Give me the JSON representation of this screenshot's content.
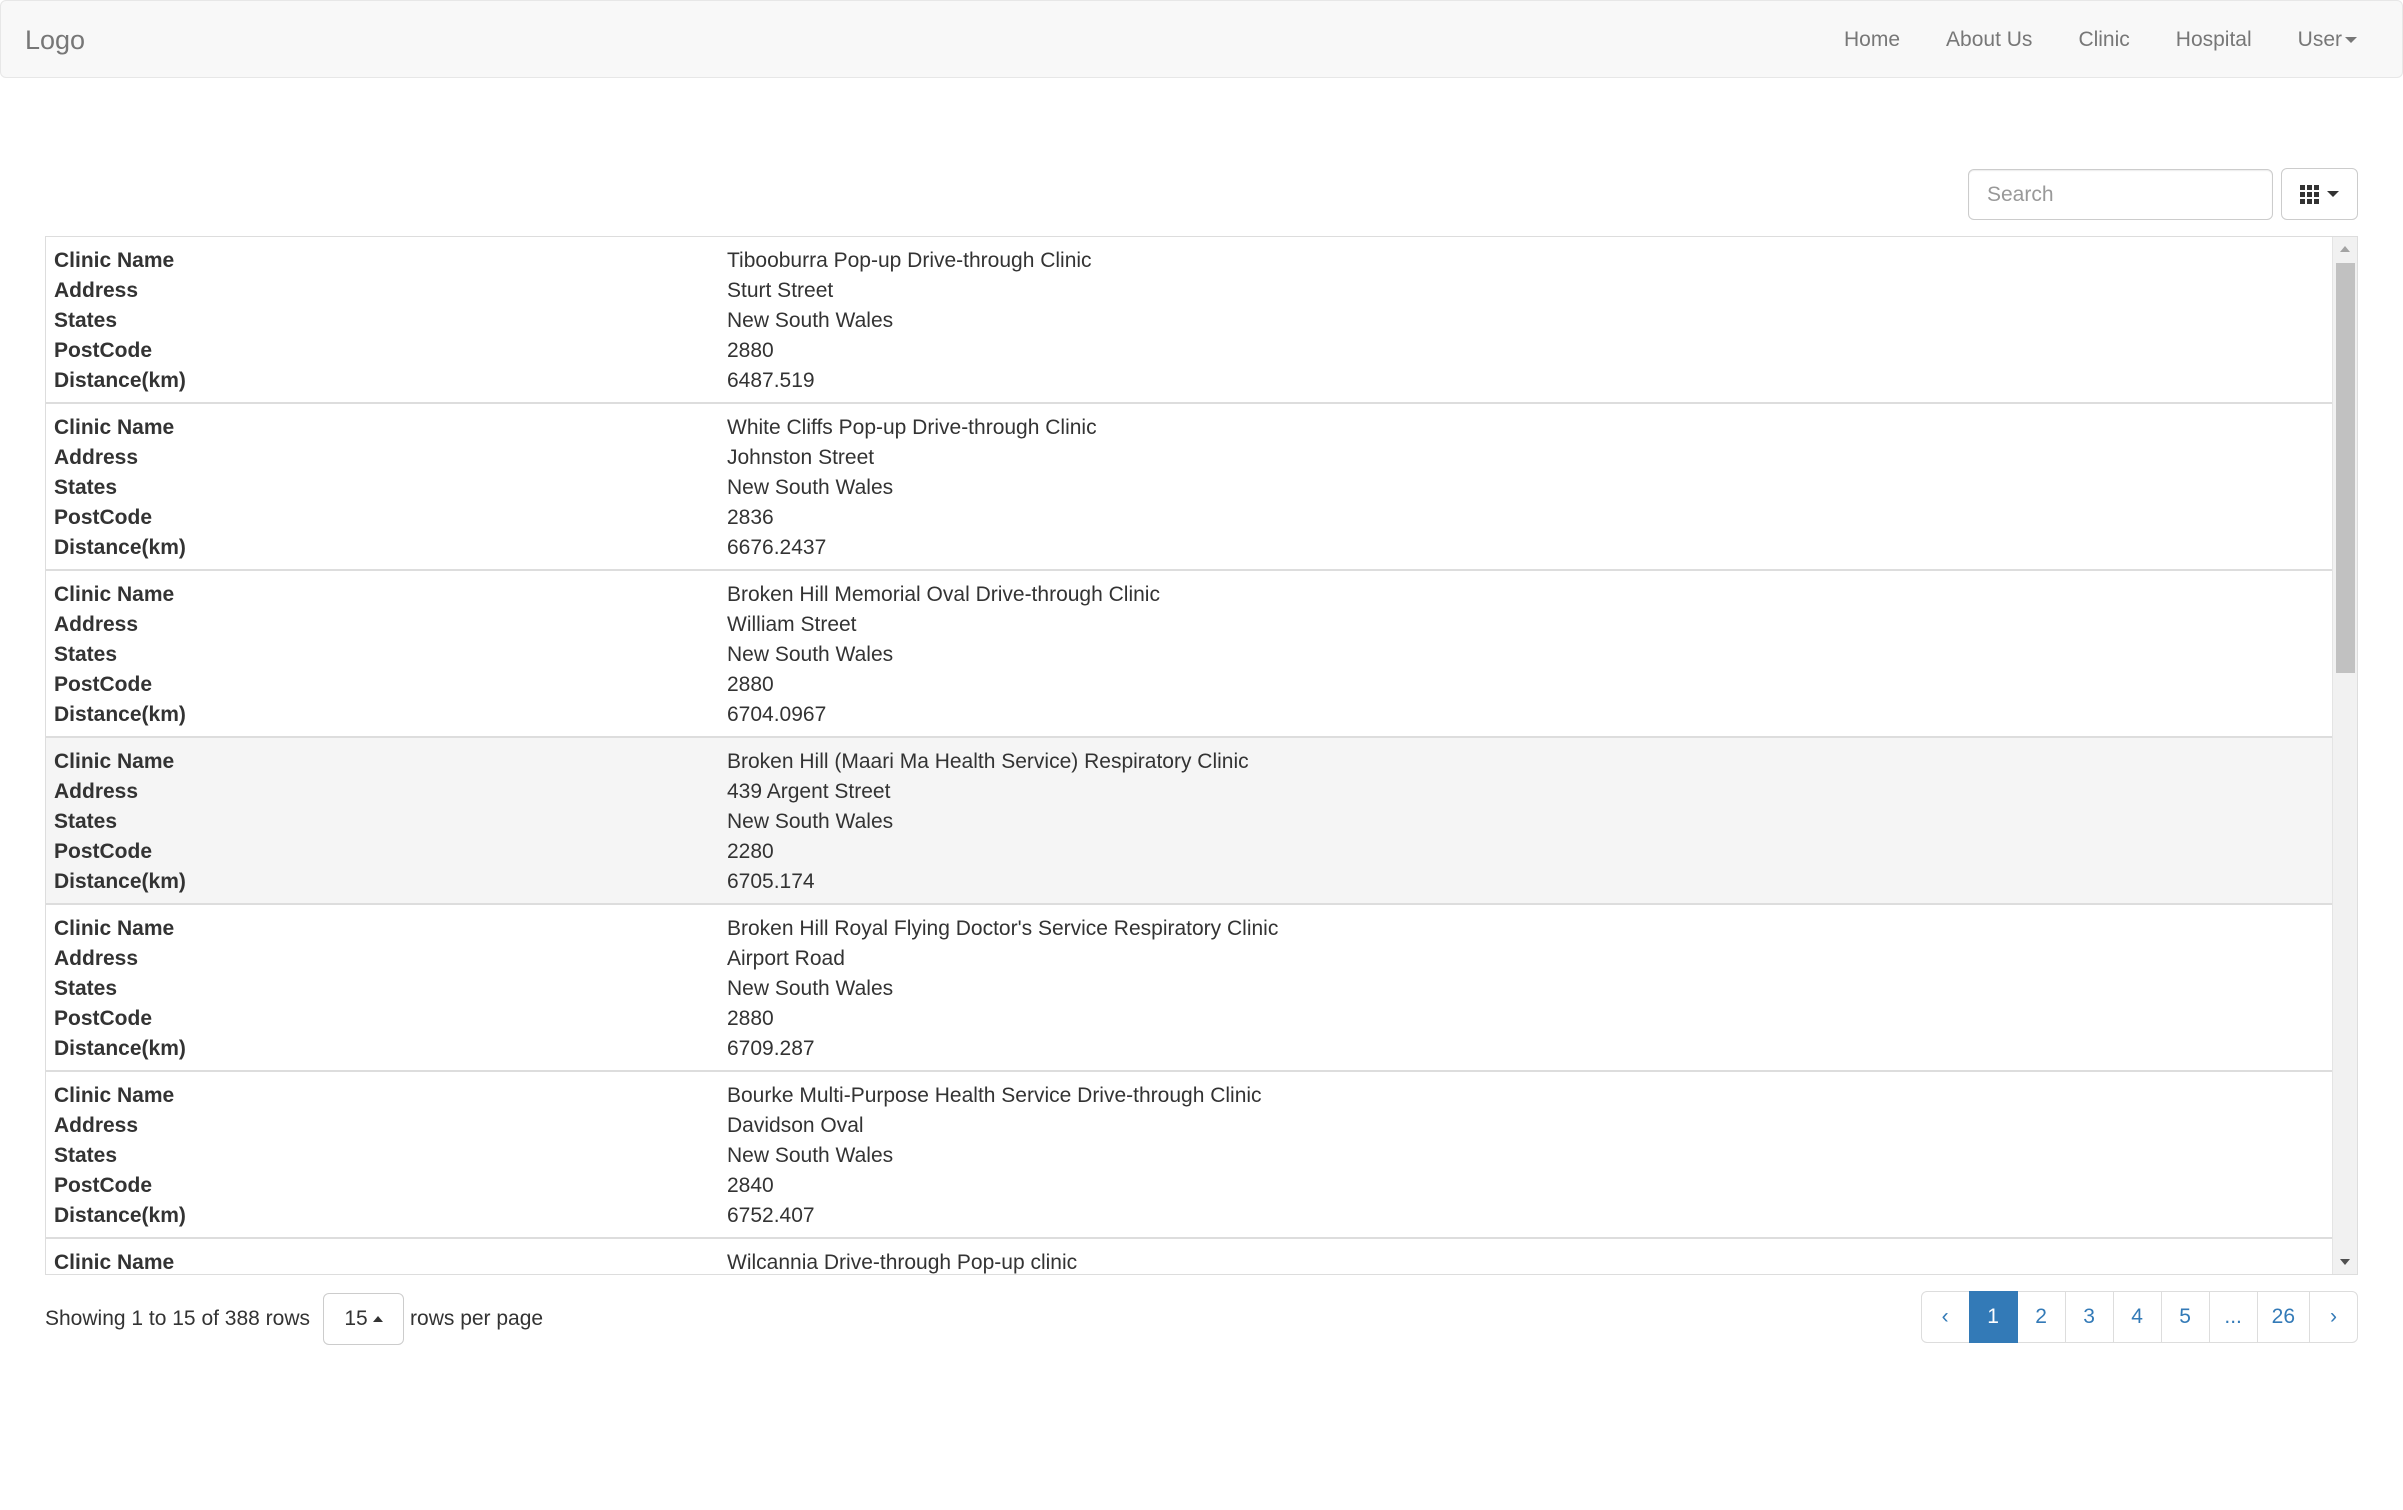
{
  "navbar": {
    "brand": "Logo",
    "links": [
      "Home",
      "About Us",
      "Clinic",
      "Hospital"
    ],
    "user_label": "User"
  },
  "toolbar": {
    "search_placeholder": "Search",
    "columns_icon": "grid-icon"
  },
  "table": {
    "field_labels": [
      "Clinic Name",
      "Address",
      "States",
      "PostCode",
      "Distance(km)"
    ],
    "records": [
      {
        "clinic_name": "Tibooburra Pop-up Drive-through Clinic",
        "address": "Sturt Street",
        "state": "New South Wales",
        "postcode": "2880",
        "distance": "6487.519"
      },
      {
        "clinic_name": "White Cliffs Pop-up Drive-through Clinic",
        "address": "Johnston Street",
        "state": "New South Wales",
        "postcode": "2836",
        "distance": "6676.2437"
      },
      {
        "clinic_name": "Broken Hill Memorial Oval Drive-through Clinic",
        "address": "William Street",
        "state": "New South Wales",
        "postcode": "2880",
        "distance": "6704.0967"
      },
      {
        "clinic_name": "Broken Hill (Maari Ma Health Service) Respiratory Clinic",
        "address": "439 Argent Street",
        "state": "New South Wales",
        "postcode": "2280",
        "distance": "6705.174"
      },
      {
        "clinic_name": "Broken Hill Royal Flying Doctor's Service Respiratory Clinic",
        "address": "Airport Road",
        "state": "New South Wales",
        "postcode": "2880",
        "distance": "6709.287"
      },
      {
        "clinic_name": "Bourke Multi-Purpose Health Service Drive-through Clinic",
        "address": "Davidson Oval",
        "state": "New South Wales",
        "postcode": "2840",
        "distance": "6752.407"
      },
      {
        "clinic_name": "Wilcannia Drive-through Pop-up clinic",
        "address": "",
        "state": "",
        "postcode": "",
        "distance": ""
      }
    ],
    "hover_record_index": 3
  },
  "pagination": {
    "info_text": "Showing 1 to 15 of 388 rows",
    "page_size": "15",
    "rows_per_page_label": "rows per page",
    "prev_label": "‹",
    "next_label": "›",
    "pages": [
      "1",
      "2",
      "3",
      "4",
      "5",
      "...",
      "26"
    ],
    "active_page": "1"
  },
  "colors": {
    "accent": "#337ab7",
    "navbar_bg": "#f8f8f8",
    "row_hover_bg": "#f5f5f5"
  }
}
